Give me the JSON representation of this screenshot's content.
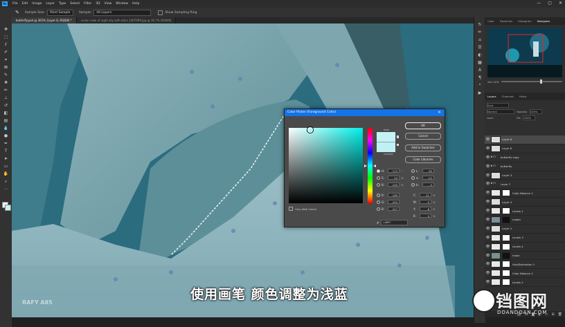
{
  "menubar": {
    "logo": "Ps",
    "items": [
      "File",
      "Edit",
      "Image",
      "Layer",
      "Type",
      "Select",
      "Filter",
      "3D",
      "View",
      "Window",
      "Help"
    ],
    "window_controls": [
      "—",
      "▢",
      "✕"
    ]
  },
  "options_bar": {
    "sample_size_label": "Sample Size:",
    "sample_size_value": "Point Sample",
    "sample_label": "Sample:",
    "sample_value": "All Layers",
    "show_ring_label": "Show Sampling Ring"
  },
  "document_tabs": [
    "butterfly.psd @ 361% (Layer 8, RGB/8) *",
    "ocean view of night sky with stars 1407999.jpg @ 16.7% (RGB/8)"
  ],
  "panel_tabs": [
    "Color",
    "Swatches",
    "Histogram",
    "Navigator"
  ],
  "navigator": {
    "zoom": "261.32%"
  },
  "layers_panel": {
    "tabs": [
      "Layers",
      "Channels",
      "Paths"
    ],
    "kind_label": "Kind",
    "blend_mode": "Normal",
    "opacity_label": "Opacity:",
    "opacity_value": "100%",
    "lock_label": "Lock:",
    "fill_label": "Fill:",
    "fill_value": "100%",
    "layers": [
      {
        "name": "Layer 8",
        "type": "normal",
        "selected": true
      },
      {
        "name": "Layer 6",
        "type": "normal"
      },
      {
        "name": "butterfly copy",
        "type": "group"
      },
      {
        "name": "butterfly",
        "type": "group"
      },
      {
        "name": "Layer 3",
        "type": "normal"
      },
      {
        "name": "Layer 7",
        "type": "group"
      },
      {
        "name": "Color Balance 1",
        "type": "adjustment"
      },
      {
        "name": "Layer 4",
        "type": "normal"
      },
      {
        "name": "Levels 1",
        "type": "adjustment"
      },
      {
        "name": "model",
        "type": "masked"
      },
      {
        "name": "Layer 2",
        "type": "normal"
      },
      {
        "name": "Levels 3",
        "type": "adjustment"
      },
      {
        "name": "Levels 4",
        "type": "adjustment"
      },
      {
        "name": "moon",
        "type": "masked"
      },
      {
        "name": "Hue/Saturation 1",
        "type": "adjustment"
      },
      {
        "name": "Color Balance 2",
        "type": "adjustment"
      },
      {
        "name": "Levels 2",
        "type": "adjustment"
      }
    ]
  },
  "color_picker": {
    "title": "Color Picker (Foreground Color)",
    "ok": "OK",
    "cancel": "Cancel",
    "add_to_swatches": "Add to Swatches",
    "color_libraries": "Color Libraries",
    "new_label": "new",
    "current_label": "current",
    "only_web_colors": "Only Web Colors",
    "new_color": "#c4f3f5",
    "hsb": {
      "H": "173",
      "S": "20",
      "B": "100"
    },
    "hsb_units": {
      "H": "°",
      "S": "%",
      "B": "%"
    },
    "rgb": {
      "R": "199",
      "G": "255",
      "B": "247"
    },
    "lab": {
      "L": "95",
      "a": "-22",
      "b": "-3"
    },
    "cmyk": {
      "C": "21",
      "M": "0",
      "Y": "8",
      "K": "0"
    },
    "cmyk_unit": "%",
    "hex_label": "#",
    "hex": "c4fff7"
  },
  "subtitle": "使用画笔 颜色调整为浅蓝",
  "watermark_left": "RAFY A85",
  "watermark_right": {
    "brand": "铛图网",
    "url": "DOANDOAN.COM"
  },
  "colors": {
    "accent": "#1473e6",
    "canvas": "#2d6f82",
    "picked": "#c4f3f5"
  }
}
